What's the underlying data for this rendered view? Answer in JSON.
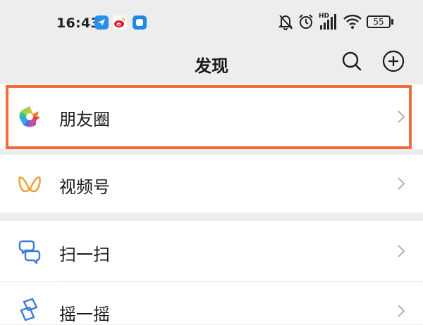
{
  "status_bar": {
    "time": "16:43",
    "app_icons": [
      "navigation-app-icon",
      "weibo-app-icon",
      "message-app-icon"
    ],
    "network_badge": "HD",
    "battery_level": "55"
  },
  "header": {
    "title": "发现",
    "actions": [
      "search-icon",
      "add-circle-icon"
    ]
  },
  "discover_list": {
    "items": [
      {
        "label": "朋友圈",
        "icon": "moments-aperture-icon"
      },
      {
        "label": "视频号",
        "icon": "channels-icon"
      },
      {
        "label": "扫一扫",
        "icon": "scan-icon"
      },
      {
        "label": "摇一摇",
        "icon": "shake-icon"
      }
    ]
  },
  "colors": {
    "background": "#ededed",
    "row": "#ffffff",
    "highlight": "#f26b3a",
    "channels_accent": "#e9a33b",
    "scan_blue": "#3b7bd6"
  }
}
